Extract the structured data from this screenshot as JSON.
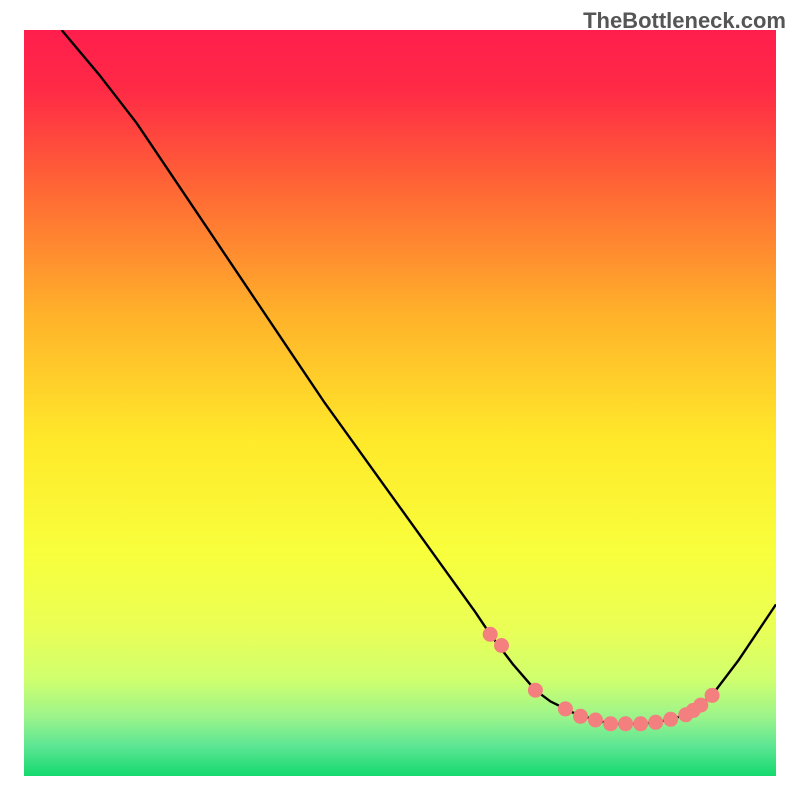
{
  "watermark": "TheBottleneck.com",
  "chart_data": {
    "type": "line",
    "title": "",
    "xlabel": "",
    "ylabel": "",
    "xlim": [
      0,
      100
    ],
    "ylim": [
      0,
      100
    ],
    "gradient_colors": {
      "top": "#ff1e4c",
      "mid_upper": "#ff9d2c",
      "mid": "#fff02a",
      "mid_lower": "#eeff52",
      "lower": "#c3ff7e",
      "bottom": "#14d96e"
    },
    "series": [
      {
        "name": "curve",
        "type": "line",
        "color": "#000000",
        "x": [
          5,
          10,
          15,
          20,
          25,
          30,
          35,
          40,
          45,
          50,
          55,
          60,
          62,
          65,
          68,
          70,
          73,
          76,
          78,
          80,
          82,
          84,
          86,
          88,
          90,
          92,
          95,
          100
        ],
        "y": [
          100,
          94,
          87.5,
          80,
          72.5,
          65,
          57.5,
          50,
          43,
          36,
          29,
          22,
          19,
          15,
          11.5,
          10,
          8.5,
          7.5,
          7,
          7,
          7,
          7.2,
          7.6,
          8.2,
          9.5,
          11.5,
          15.5,
          23
        ]
      },
      {
        "name": "markers",
        "type": "scatter",
        "color": "#f47f7f",
        "x": [
          62,
          63.5,
          68,
          72,
          74,
          76,
          78,
          80,
          82,
          84,
          86,
          88,
          89,
          90,
          91.5
        ],
        "y": [
          19,
          17.5,
          11.5,
          9,
          8,
          7.5,
          7,
          7,
          7,
          7.2,
          7.6,
          8.2,
          8.8,
          9.5,
          10.8
        ]
      }
    ]
  }
}
